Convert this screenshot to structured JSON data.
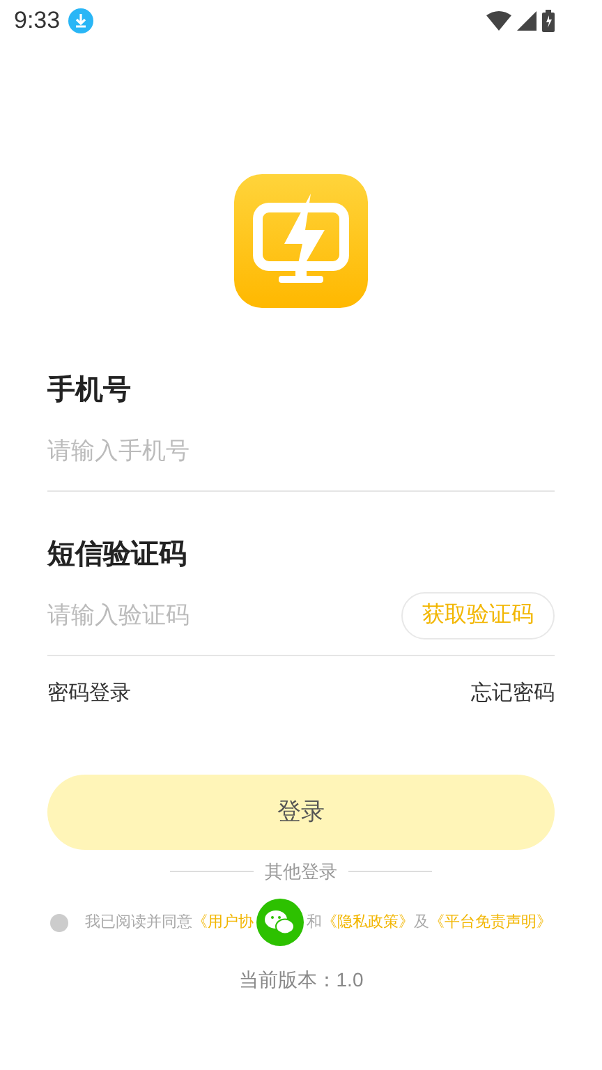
{
  "status_bar": {
    "time": "9:33"
  },
  "phone": {
    "label": "手机号",
    "placeholder": "请输入手机号"
  },
  "code": {
    "label": "短信验证码",
    "placeholder": "请输入验证码",
    "button": "获取验证码"
  },
  "links": {
    "password_login": "密码登录",
    "forgot_password": "忘记密码"
  },
  "login_button": "登录",
  "other_login": "其他登录",
  "agreement": {
    "checked": false,
    "parts": [
      {
        "kind": "plain",
        "text": "我已阅读并同意"
      },
      {
        "kind": "link",
        "text": "《用户协"
      },
      {
        "kind": "wechat"
      },
      {
        "kind": "plain",
        "text": "和"
      },
      {
        "kind": "link",
        "text": "《隐私政策》"
      },
      {
        "kind": "plain",
        "text": "及"
      },
      {
        "kind": "link",
        "text": "《平台免责声明》"
      }
    ]
  },
  "version": "当前版本：1.0"
}
